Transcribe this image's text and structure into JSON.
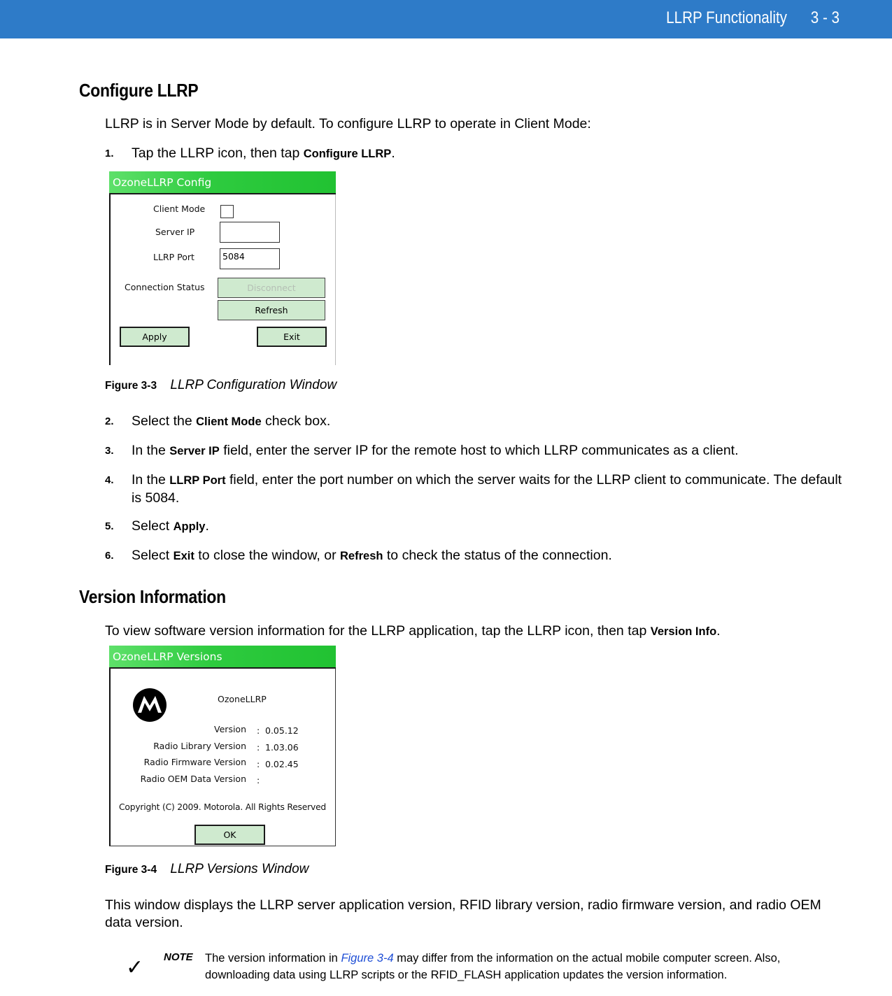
{
  "header": {
    "title": "LLRP Functionality",
    "page": "3 - 3",
    "bar_color": "#2e7bc8"
  },
  "configure": {
    "heading": "Configure LLRP",
    "intro": "LLRP is in Server Mode by default. To configure LLRP to operate in Client Mode:",
    "steps": [
      {
        "num": "1.",
        "pre": "Tap the LLRP icon, then tap ",
        "bold": "Configure LLRP",
        "post": "."
      },
      {
        "num": "2.",
        "pre": "Select the ",
        "bold": "Client Mode",
        "post": " check box."
      },
      {
        "num": "3.",
        "pre": "In the ",
        "bold": "Server IP",
        "post": " field, enter the server IP for the remote host to which LLRP communicates as a client."
      },
      {
        "num": "4.",
        "pre": "In the ",
        "bold": "LLRP Port",
        "post": " field, enter the port number on which the server waits for the LLRP client to communicate. The default is 5084."
      },
      {
        "num": "5.",
        "pre": "Select ",
        "bold": "Apply",
        "post": "."
      },
      {
        "num": "6.",
        "pre": "Select ",
        "bold": "Exit",
        "mid": " to close the window, or ",
        "bold2": "Refresh",
        "post": " to check the status of the connection."
      }
    ],
    "figure": {
      "label": "Figure 3-3",
      "title": "LLRP Configuration Window"
    },
    "window": {
      "title": "OzoneLLRP Config",
      "client_mode_label": "Client Mode",
      "client_mode_checked": false,
      "server_ip_label": "Server IP",
      "server_ip_value": "",
      "llrp_port_label": "LLRP Port",
      "llrp_port_value": "5084",
      "connection_status_label": "Connection Status",
      "disconnect_button": "Disconnect",
      "refresh_button": "Refresh",
      "apply_button": "Apply",
      "exit_button": "Exit",
      "title_bar_color": "#2ecb3f",
      "button_color": "#cfeacf"
    }
  },
  "version": {
    "heading": "Version Information",
    "intro_pre": "To view software version information for the LLRP application, tap the LLRP icon, then tap ",
    "intro_bold": "Version Info",
    "intro_post": ".",
    "figure": {
      "label": "Figure 3-4",
      "title": "LLRP Versions Window"
    },
    "description": "This window displays the LLRP server application version, RFID library version, radio firmware version, and radio OEM data version.",
    "window": {
      "title": "OzoneLLRP Versions",
      "logo": "motorola-logo-icon",
      "app_name": "OzoneLLRP",
      "rows": [
        {
          "label": "Version",
          "value": "0.05.12"
        },
        {
          "label": "Radio Library Version",
          "value": "1.03.06"
        },
        {
          "label": "Radio Firmware Version",
          "value": "0.02.45"
        },
        {
          "label": "Radio OEM Data Version",
          "value": ""
        }
      ],
      "separator": ":",
      "copyright": "Copyright (C) 2009. Motorola. All Rights Reserved",
      "ok_button": "OK"
    }
  },
  "note": {
    "icon": "checkmark-icon",
    "label": "NOTE",
    "pre": "The version information in ",
    "link": "Figure 3-4",
    "post": " may differ from the information on the actual mobile computer screen. Also, downloading data using LLRP scripts or the RFID_FLASH application updates the version information.",
    "link_color": "#1f4fd6"
  }
}
